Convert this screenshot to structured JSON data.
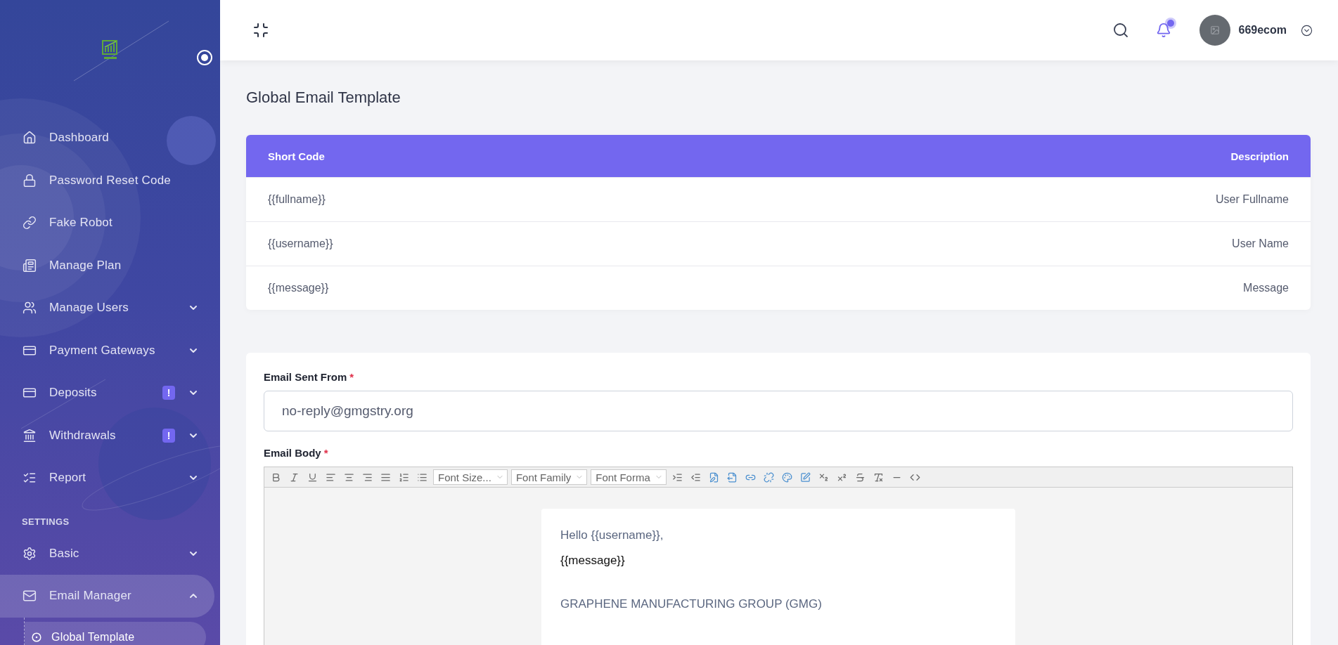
{
  "sidebar": {
    "sections": [
      {
        "items": [
          {
            "label": "Dashboard",
            "selected": false
          },
          {
            "label": "Password Reset Code",
            "selected": false
          },
          {
            "label": "Fake Robot",
            "selected": false
          },
          {
            "label": "Manage Plan",
            "selected": false
          },
          {
            "label": "Manage Users",
            "selected": false,
            "expanded": false
          },
          {
            "label": "Payment Gateways",
            "selected": false,
            "expanded": false
          },
          {
            "label": "Deposits",
            "selected": false,
            "expanded": false,
            "badge": "!"
          },
          {
            "label": "Withdrawals",
            "selected": false,
            "expanded": false,
            "badge": "!"
          },
          {
            "label": "Report",
            "selected": false,
            "expanded": false
          }
        ]
      },
      {
        "heading": "SETTINGS",
        "items": [
          {
            "label": "Basic",
            "selected": false,
            "expanded": false
          },
          {
            "label": "Email Manager",
            "selected": true,
            "expanded": true,
            "children": [
              {
                "label": "Global Template",
                "selected": true
              }
            ]
          }
        ]
      }
    ]
  },
  "header": {
    "username": "669ecom",
    "has_notifications": true
  },
  "page_title": "Global Email Template",
  "shortcodes": {
    "columns": [
      "Short Code",
      "Description"
    ],
    "rows": [
      [
        "{{fullname}}",
        "User Fullname"
      ],
      [
        "{{username}}",
        "User Name"
      ],
      [
        "{{message}}",
        "Message"
      ]
    ]
  },
  "sender_field": {
    "label": "Email Sent From",
    "required_mark": "*",
    "value": "no-reply@gmgstry.org"
  },
  "body_editor": {
    "label": "Email Body",
    "required_mark": "*",
    "selects": [
      "Font Size...",
      "Font Family",
      "Font Forma"
    ],
    "content": [
      {
        "kind": "greeting",
        "text": "Hello {{username}},"
      },
      {
        "kind": "body",
        "text": "{{message}}"
      },
      {
        "kind": "footer",
        "text": "GRAPHENE MANUFACTURING GROUP (GMG)"
      }
    ]
  }
}
